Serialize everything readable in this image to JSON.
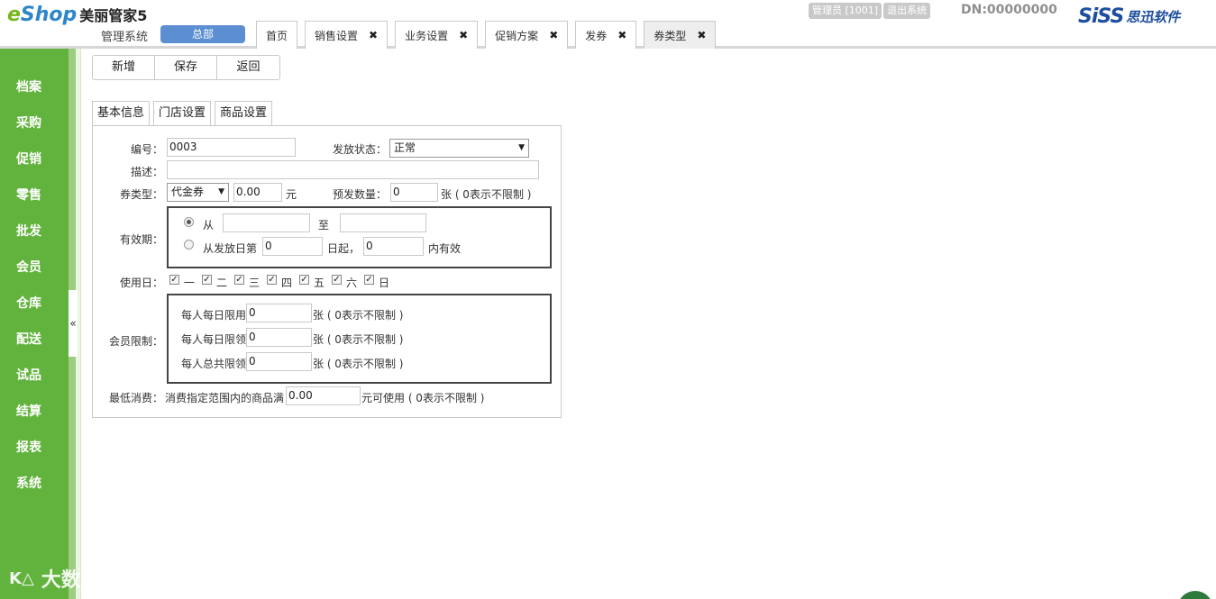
{
  "header": {
    "logo_e": "e",
    "logo_shop": "Shop",
    "logo_cn": "美丽管家5",
    "system_name": "管理系统",
    "branch_button": "总部",
    "user_name": "管理员 [1001]",
    "logout": "退出系统",
    "dn": "DN:00000000",
    "brand_en": "SiSS",
    "brand_cn": "思迅软件"
  },
  "tabs": [
    {
      "label": "首页",
      "closable": false
    },
    {
      "label": "销售设置",
      "closable": true
    },
    {
      "label": "业务设置",
      "closable": true
    },
    {
      "label": "促销方案",
      "closable": true
    },
    {
      "label": "发券",
      "closable": true
    },
    {
      "label": "券类型",
      "closable": true,
      "active": true
    }
  ],
  "close_glyph": "✖",
  "sidebar": {
    "items": [
      "档案",
      "采购",
      "促销",
      "零售",
      "批发",
      "会员",
      "仓库",
      "配送",
      "试品",
      "结算",
      "报表",
      "系统"
    ],
    "collapse": "«"
  },
  "toolbar": {
    "new": "新增",
    "save": "保存",
    "back": "返回"
  },
  "form_tabs": [
    "基本信息",
    "门店设置",
    "商品设置"
  ],
  "form": {
    "code_label": "编号：",
    "code_value": "0003",
    "status_label": "发放状态：",
    "status_value": "正常",
    "desc_label": "描述：",
    "desc_value": "",
    "type_label": "券类型：",
    "type_value": "代金券",
    "amount_value": "0.00",
    "amount_unit": "元",
    "qty_label": "预发数量：",
    "qty_value": "0",
    "qty_unit": "张 ( 0表示不限制 )",
    "validity_label": "有效期：",
    "from_label": "从",
    "to_label": "至",
    "from_value": "",
    "to_value": "",
    "from_issue_label": "从发放日第",
    "from_issue_value": "0",
    "days_label": "日起，",
    "days_value": "0",
    "within_label": "内有效",
    "use_day_label": "使用日：",
    "weekdays": [
      "一",
      "二",
      "三",
      "四",
      "五",
      "六",
      "日"
    ],
    "member_label": "会员限制：",
    "member_rows": [
      {
        "label": "每人每日限用",
        "value": "0",
        "unit": "张 ( 0表示不限制 )"
      },
      {
        "label": "每人每日限领",
        "value": "0",
        "unit": "张 ( 0表示不限制 )"
      },
      {
        "label": "每人总共限领",
        "value": "0",
        "unit": "张 ( 0表示不限制 )"
      }
    ],
    "min_label": "最低消费：",
    "min_text": "消费指定范围内的商品满",
    "min_value": "0.00",
    "min_unit": "元可使用 ( 0表示不限制 )"
  },
  "watermark": {
    "logo": "K△",
    "text": "大数跨境"
  }
}
